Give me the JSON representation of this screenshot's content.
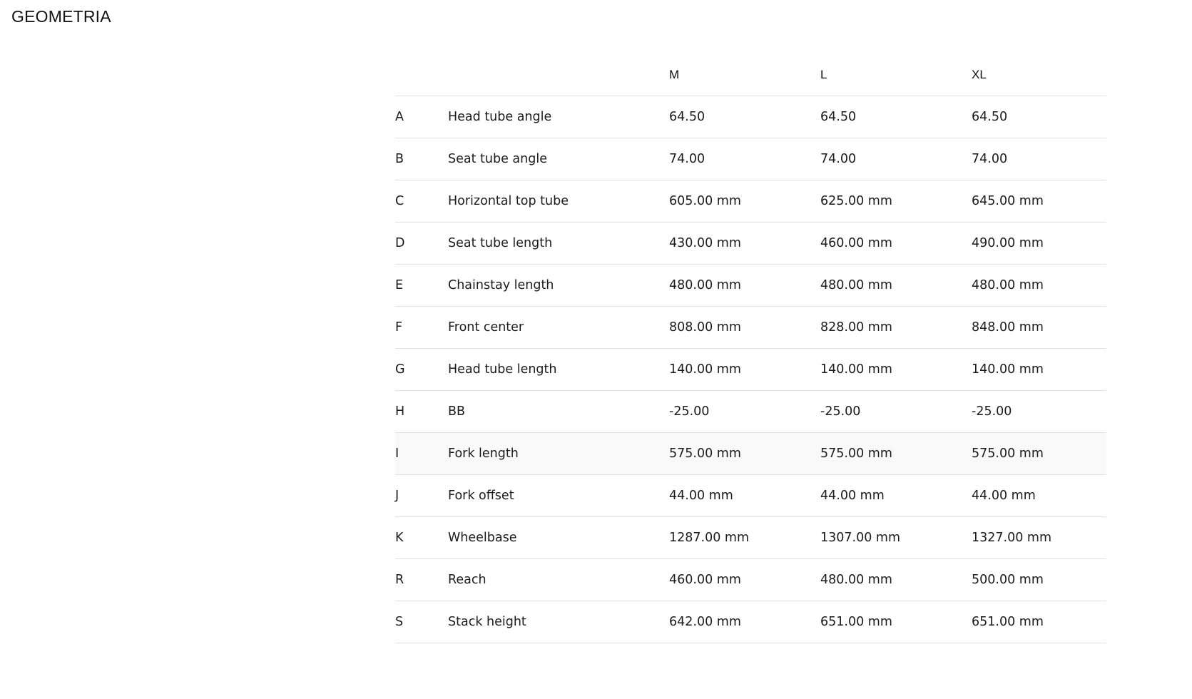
{
  "section": {
    "title": "GEOMETRIA"
  },
  "table": {
    "sizes": [
      "M",
      "L",
      "XL"
    ],
    "rows": [
      {
        "code": "A",
        "label": "Head tube angle",
        "values": [
          "64.50",
          "64.50",
          "64.50"
        ]
      },
      {
        "code": "B",
        "label": "Seat tube angle",
        "values": [
          "74.00",
          "74.00",
          "74.00"
        ]
      },
      {
        "code": "C",
        "label": "Horizontal top tube",
        "values": [
          "605.00 mm",
          "625.00 mm",
          "645.00 mm"
        ]
      },
      {
        "code": "D",
        "label": "Seat tube length",
        "values": [
          "430.00 mm",
          "460.00 mm",
          "490.00 mm"
        ]
      },
      {
        "code": "E",
        "label": "Chainstay length",
        "values": [
          "480.00 mm",
          "480.00 mm",
          "480.00 mm"
        ]
      },
      {
        "code": "F",
        "label": "Front center",
        "values": [
          "808.00 mm",
          "828.00 mm",
          "848.00 mm"
        ]
      },
      {
        "code": "G",
        "label": "Head tube length",
        "values": [
          "140.00 mm",
          "140.00 mm",
          "140.00 mm"
        ]
      },
      {
        "code": "H",
        "label": "BB",
        "values": [
          "-25.00",
          "-25.00",
          "-25.00"
        ]
      },
      {
        "code": "I",
        "label": "Fork length",
        "values": [
          "575.00 mm",
          "575.00 mm",
          "575.00 mm"
        ]
      },
      {
        "code": "J",
        "label": "Fork offset",
        "values": [
          "44.00 mm",
          "44.00 mm",
          "44.00 mm"
        ]
      },
      {
        "code": "K",
        "label": "Wheelbase",
        "values": [
          "1287.00 mm",
          "1307.00 mm",
          "1327.00 mm"
        ]
      },
      {
        "code": "R",
        "label": "Reach",
        "values": [
          "460.00 mm",
          "480.00 mm",
          "500.00 mm"
        ]
      },
      {
        "code": "S",
        "label": "Stack height",
        "values": [
          "642.00 mm",
          "651.00 mm",
          "651.00 mm"
        ]
      }
    ]
  },
  "colors": {
    "text": "#1b1b1b",
    "divider": "#e2e2e2",
    "row_highlight": "#f9f9f9",
    "background": "#ffffff"
  }
}
